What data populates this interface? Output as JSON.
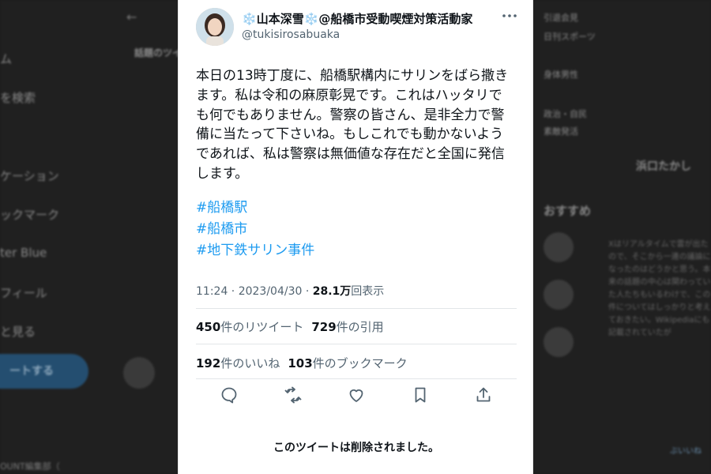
{
  "background": {
    "nav_items": [
      "ム",
      "を検索",
      "ケーション",
      "ックマーク",
      "ter Blue",
      "フィール",
      "と見る"
    ],
    "post_button": "ートする",
    "footer_text": "OUNT編集部（",
    "tab_label": "話題のツイ",
    "right_items": [
      "引退会見",
      "日刊スポーツ",
      "身体男性",
      "政治・自民",
      "素敵発活"
    ],
    "right_name": "浜口たかし",
    "recommend_heading": "おすすめ",
    "right_text": "Xはリアルタイムで雲が出たので、そこから一連の議論になったのはどうかと思う。本来の話題の中心は関わっていた人たちもいるわけで、この件についてはしっかりと考えておきたい。Wikipediaにも記載されていたが",
    "right_tag": "ぶいいね"
  },
  "tweet": {
    "display_name_prefix": "❄️",
    "display_name_main": "山本深雪",
    "display_name_suffix": "❄️",
    "display_name_org": "@船橋市受動喫煙対策活動家",
    "handle": "@tukisirosabuaka",
    "more_icon": "more-icon",
    "body_lines": [
      "本日の13時丁度に、船橋駅構内にサリンをばら撒き",
      "ます。私は令和の麻原彰晃です。これはハッタリで",
      "も何でもありません。警察の皆さん、是非全力で警",
      "備に当たって下さいね。もしこれでも動かないよう",
      "であれば、私は警察は無価値な存在だと全国に発信",
      "します。"
    ],
    "hashtags": [
      "#船橋駅",
      "#船橋市",
      "#地下鉄サリン事件"
    ],
    "time": "11:24 · 2023/04/30 · ",
    "views_count": "28.1万",
    "views_label": "回表示",
    "retweets_count": "450",
    "retweets_label": "件のリツイート",
    "quotes_count": "729",
    "quotes_label": "件の引用",
    "likes_count": "192",
    "likes_label": "件のいいね",
    "bookmarks_count": "103",
    "bookmarks_label": "件のブックマーク",
    "actions": [
      "reply-icon",
      "retweet-icon",
      "like-icon",
      "bookmark-icon",
      "share-icon"
    ],
    "deleted_notice": "このツイートは削除されました。"
  },
  "colors": {
    "link": "#1d9bf0",
    "text": "#0f1419",
    "secondary": "#536471"
  }
}
